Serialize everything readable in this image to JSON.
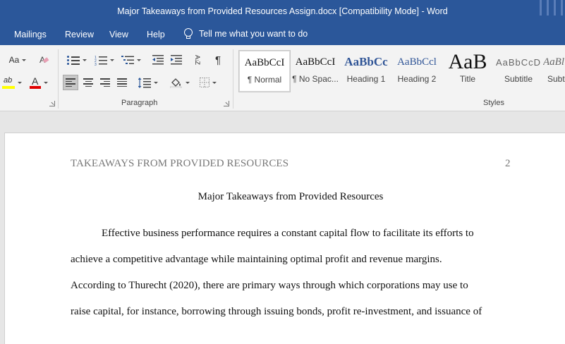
{
  "window": {
    "title": "Major Takeaways from Provided Resources Assign.docx [Compatibility Mode]  -  Word"
  },
  "menu": {
    "tabs": [
      "Mailings",
      "Review",
      "View",
      "Help"
    ],
    "tell_me": "Tell me what you want to do"
  },
  "ribbon": {
    "font_group": {
      "change_case_label": "Aa",
      "icons": [
        "change-case-icon",
        "clear-formatting-icon",
        "text-highlight-icon",
        "font-color-icon"
      ],
      "highlight_label": "ab",
      "font_color_label": "A",
      "accent_colors": {
        "highlight": "#ffff00",
        "font_color": "#e00000"
      }
    },
    "paragraph_group": {
      "label": "Paragraph",
      "show_marks_label": "¶",
      "sort_label": "A↓Z"
    },
    "styles_group": {
      "label": "Styles",
      "styles": [
        {
          "sample": "AaBbCcI",
          "name": "¶ Normal",
          "selected": true
        },
        {
          "sample": "AaBbCcI",
          "name": "¶ No Spac...",
          "selected": false
        },
        {
          "sample": "AaBbCc",
          "name": "Heading 1",
          "selected": false
        },
        {
          "sample": "AaBbCcl",
          "name": "Heading 2",
          "selected": false
        },
        {
          "sample": "AaB",
          "name": "Title",
          "selected": false
        },
        {
          "sample": "AaBbCcD",
          "name": "Subtitle",
          "selected": false
        },
        {
          "sample": "AaBl",
          "name": "Subt",
          "selected": false
        }
      ]
    }
  },
  "document": {
    "header": "TAKEAWAYS FROM PROVIDED RESOURCES",
    "page_number": "2",
    "title": "Major Takeaways from Provided Resources",
    "lines": [
      "Effective business performance requires a constant capital flow to facilitate its efforts to",
      "achieve a competitive advantage while maintaining optimal profit and revenue margins.",
      "According to Thurecht (2020), there are primary ways through which corporations may use to",
      "raise capital, for instance, borrowing through issuing bonds, profit re-investment, and issuance of"
    ]
  },
  "colors": {
    "title_bar": "#2b579a",
    "ribbon": "#f3f3f3",
    "document_bg": "#e6e6e6"
  }
}
